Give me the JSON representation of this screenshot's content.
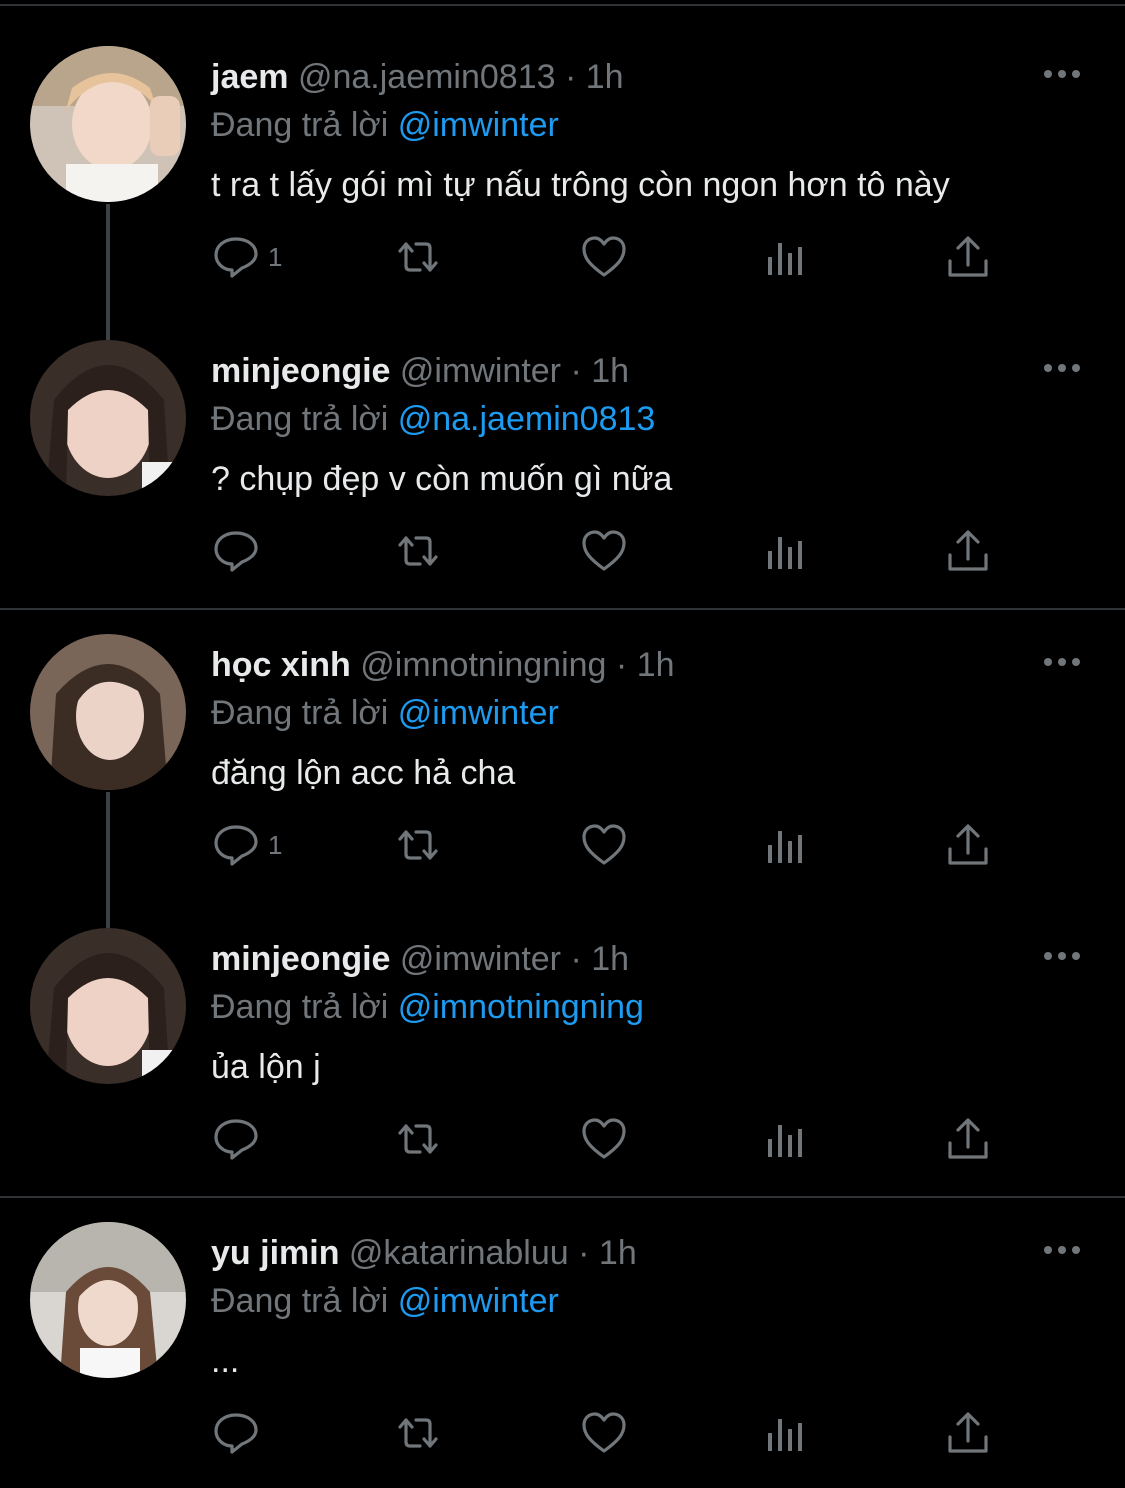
{
  "tweets": [
    {
      "name": "jaem",
      "handle": "@na.jaemin0813",
      "time": "· 1h",
      "reply_prefix": "Đang trả lời",
      "reply_to": "@imwinter",
      "text": "t ra t lấy gói mì tự nấu trông còn ngon hơn tô này",
      "reply_count": "1"
    },
    {
      "name": "minjeongie",
      "handle": "@imwinter",
      "time": "· 1h",
      "reply_prefix": "Đang trả lời",
      "reply_to": "@na.jaemin0813",
      "text": "? chụp đẹp v còn muốn gì nữa",
      "reply_count": ""
    },
    {
      "name": "học xinh",
      "handle": "@imnotningning",
      "time": "· 1h",
      "reply_prefix": "Đang trả lời",
      "reply_to": "@imwinter",
      "text": "đăng lộn acc hả cha",
      "reply_count": "1"
    },
    {
      "name": "minjeongie",
      "handle": "@imwinter",
      "time": "· 1h",
      "reply_prefix": "Đang trả lời",
      "reply_to": "@imnotningning",
      "text": "ủa lộn j",
      "reply_count": ""
    },
    {
      "name": "yu jimin",
      "handle": "@katarinabluu",
      "time": "· 1h",
      "reply_prefix": "Đang trả lời",
      "reply_to": "@imwinter",
      "text": "...",
      "reply_count": ""
    }
  ],
  "colors": {
    "background": "#000000",
    "text": "#e7e9ea",
    "muted": "#71767b",
    "link": "#1d9bf0",
    "divider": "#2f3336"
  },
  "icons": [
    "reply-icon",
    "retweet-icon",
    "like-icon",
    "views-icon",
    "share-icon",
    "more-icon"
  ]
}
